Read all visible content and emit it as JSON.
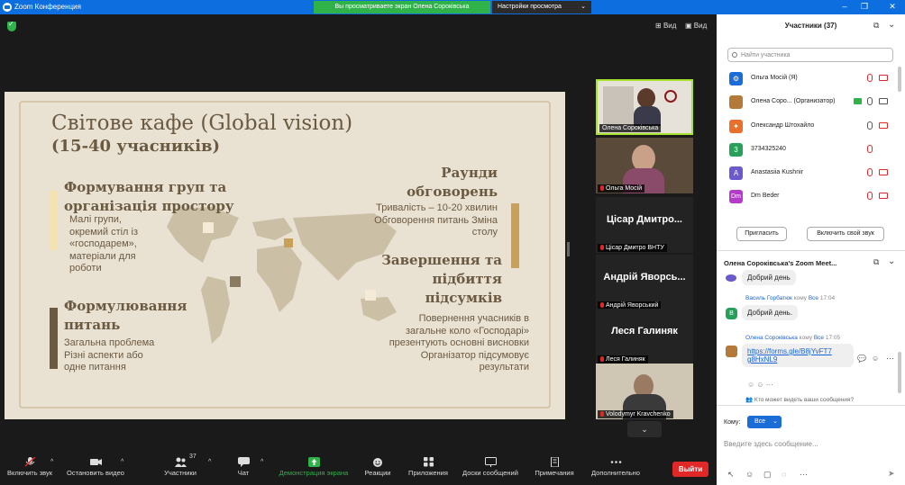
{
  "window": {
    "title": "Zoom Конференция",
    "share_notice": "Вы просматриваете экран Олена Сороківська",
    "view_options": "Настройки просмотра"
  },
  "stage": {
    "view_label": "Вид",
    "view_label2": "Вид"
  },
  "slide": {
    "title": "Світове кафе (Global vision)",
    "subtitle": "(15-40 учасників)",
    "h1": "Формування груп та організація простору",
    "t1": "Малі групи, окремий стіл із «господарем», матеріали для роботи",
    "h2": "Формулювання питань",
    "t2": "Загальна проблема Різні аспекти або одне питання",
    "h3": "Раунди обговорень",
    "t3": "Тривалість – 10-20 хвилин Обговорення питань Зміна столу",
    "h4": "Завершення та підбиття підсумків",
    "t4": "Повернення учасників в загальне коло «Господарі» презентують основні висновки Організатор підсумовує результати"
  },
  "thumbnails": [
    {
      "name": "Олена Сороківська",
      "big": ""
    },
    {
      "name": "Ольга Мосій",
      "big": ""
    },
    {
      "name": "Цісар Дмитро ВНТУ",
      "big": "Цісар Дмитро..."
    },
    {
      "name": "Андрій Яворський",
      "big": "Андрій Яворсь..."
    },
    {
      "name": "Леся Галиняк",
      "big": "Леся Галиняк"
    },
    {
      "name": "Volodymyr Kravchenko",
      "big": ""
    }
  ],
  "toolbar": {
    "mute": "Включить звук",
    "video": "Остановить видео",
    "participants": "Участники",
    "participants_count": "37",
    "chat": "Чат",
    "share": "Демонстрация экрана",
    "reactions": "Реакции",
    "apps": "Приложения",
    "whiteboard": "Доски сообщений",
    "notes": "Примечания",
    "more": "Дополнительно",
    "leave": "Выйти"
  },
  "participants": {
    "header": "Участники (37)",
    "search_placeholder": "Найти участника",
    "list": [
      {
        "name": "Ольга Мосій (Я)",
        "initial": "",
        "color": "#1a6cd6"
      },
      {
        "name": "Олена Соро... (Организатор)",
        "initial": "",
        "color": "#b47a3a"
      },
      {
        "name": "Олександр Штохайло",
        "initial": "",
        "color": "#e8702a"
      },
      {
        "name": "3734325240",
        "initial": "3",
        "color": "#28a05a"
      },
      {
        "name": "Anastasiia Kushnir",
        "initial": "A",
        "color": "#6a5acd"
      },
      {
        "name": "Dm Beder",
        "initial": "Dm",
        "color": "#b43cc8"
      }
    ],
    "invite": "Пригласить",
    "unmute_me": "Включить свой звук"
  },
  "chat": {
    "header": "Олена Сороківська's Zoom Meet...",
    "msg1": "Добрий день",
    "from2": "Василь Горбатюк",
    "to_label": "кому",
    "to2": "Все",
    "time2": "17:04",
    "msg2": "Добрий день.",
    "from3": "Олена Сороківська",
    "to3": "Все",
    "time3": "17:05",
    "link_a": "https://forms.gle/B8jYvFT7",
    "link_b": "g8HxNL9",
    "who_sees": "Кто может видеть ваши сообщения?",
    "to_prompt": "Кому:",
    "to_value": "Все",
    "placeholder": "Введите здесь сообщение..."
  }
}
